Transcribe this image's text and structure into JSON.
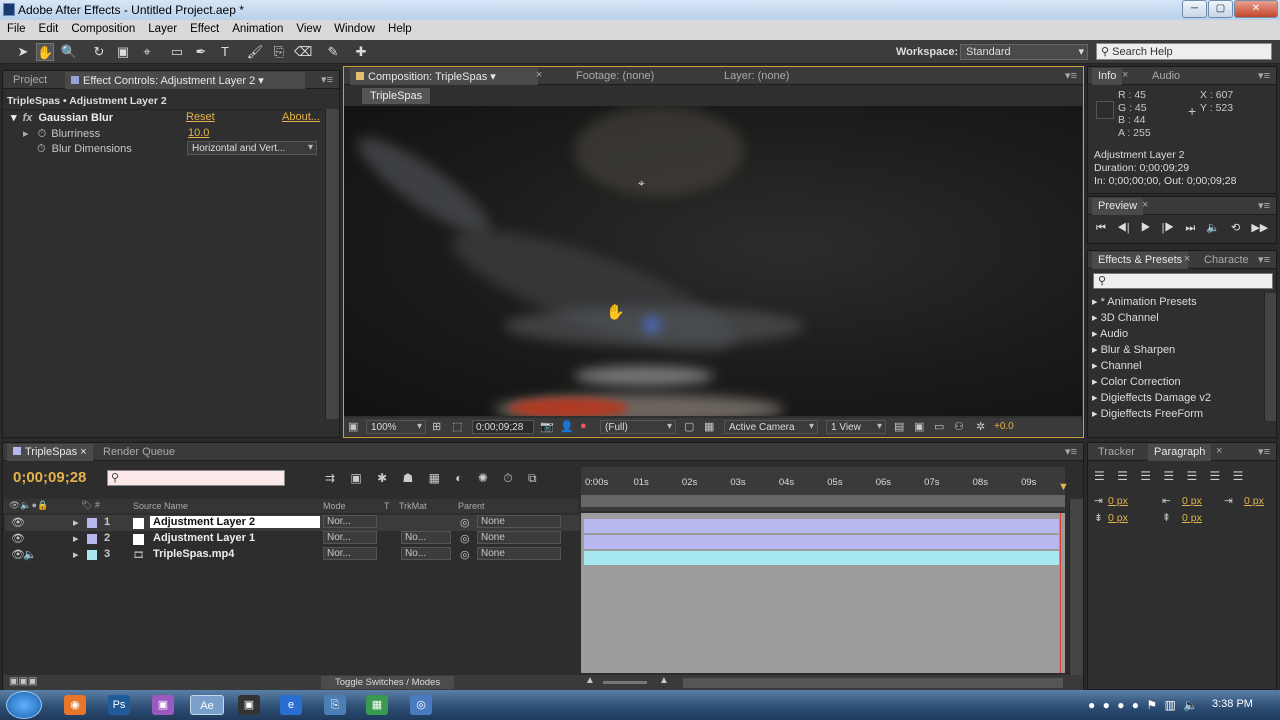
{
  "window": {
    "title": "Adobe After Effects - Untitled Project.aep *",
    "min": "─",
    "max": "▢",
    "close": "✕"
  },
  "menu": [
    "File",
    "Edit",
    "Composition",
    "Layer",
    "Effect",
    "Animation",
    "View",
    "Window",
    "Help"
  ],
  "toolbar": {
    "workspace_label": "Workspace:",
    "workspace_value": "Standard",
    "search_placeholder": "Search Help"
  },
  "project_panel": {
    "tab_project": "Project",
    "tab_effect_controls": "Effect Controls: Adjustment Layer 2",
    "breadcrumb": "TripleSpas • Adjustment Layer 2",
    "effect_name": "Gaussian Blur",
    "reset": "Reset",
    "about": "About...",
    "blurriness_label": "Blurriness",
    "blurriness_value": "10.0",
    "blur_dim_label": "Blur Dimensions",
    "blur_dim_value": "Horizontal and Vert..."
  },
  "comp_panel": {
    "tab_comp": "Composition: TripleSpas",
    "tab_footage": "Footage: (none)",
    "tab_layer": "Layer: (none)",
    "comp_tab": "TripleSpas",
    "zoom": "100%",
    "timecode": "0;00;09;28",
    "resolution": "(Full)",
    "camera": "Active Camera",
    "views": "1 View",
    "exposure": "+0.0"
  },
  "info_panel": {
    "tab_info": "Info",
    "tab_audio": "Audio",
    "r": "R : 45",
    "g": "G : 45",
    "b": "B : 44",
    "a": "A : 255",
    "x": "X : 607",
    "y": "Y : 523",
    "layer_name": "Adjustment Layer 2",
    "duration": "Duration: 0;00;09;29",
    "inout": "In: 0;00;00;00, Out: 0;00;09;28",
    "swatch_color": "#2d2d2c"
  },
  "preview_panel": {
    "tab": "Preview"
  },
  "effects_panel": {
    "tab": "Effects & Presets",
    "tab_char": "Characte",
    "items": [
      "* Animation Presets",
      "3D Channel",
      "Audio",
      "Blur & Sharpen",
      "Channel",
      "Color Correction",
      "Digieffects Damage v2",
      "Digieffects FreeForm"
    ]
  },
  "timeline": {
    "tab_comp": "TripleSpas",
    "tab_render": "Render Queue",
    "timecode": "0;00;09;28",
    "columns": {
      "source": "Source Name",
      "mode": "Mode",
      "t": "T",
      "trkmat": "TrkMat",
      "parent": "Parent"
    },
    "layers": [
      {
        "num": "1",
        "name": "Adjustment Layer 2",
        "mode": "Nor...",
        "trkmat": "",
        "parent": "None",
        "color": "#b8b8f0"
      },
      {
        "num": "2",
        "name": "Adjustment Layer 1",
        "mode": "Nor...",
        "trkmat": "No...",
        "parent": "None",
        "color": "#b8b8f0"
      },
      {
        "num": "3",
        "name": "TripleSpas.mp4",
        "mode": "Nor...",
        "trkmat": "No...",
        "parent": "None",
        "color": "#a8e8f0"
      }
    ],
    "ruler": [
      "0:00s",
      "01s",
      "02s",
      "03s",
      "04s",
      "05s",
      "06s",
      "07s",
      "08s",
      "09s"
    ],
    "toggle": "Toggle Switches / Modes"
  },
  "paragraph_panel": {
    "tab_tracker": "Tracker",
    "tab_paragraph": "Paragraph",
    "px1": "0 px",
    "px2": "0 px",
    "px3": "0 px",
    "px4": "0 px",
    "px5": "0 px"
  },
  "taskbar": {
    "clock": "3:38 PM"
  }
}
